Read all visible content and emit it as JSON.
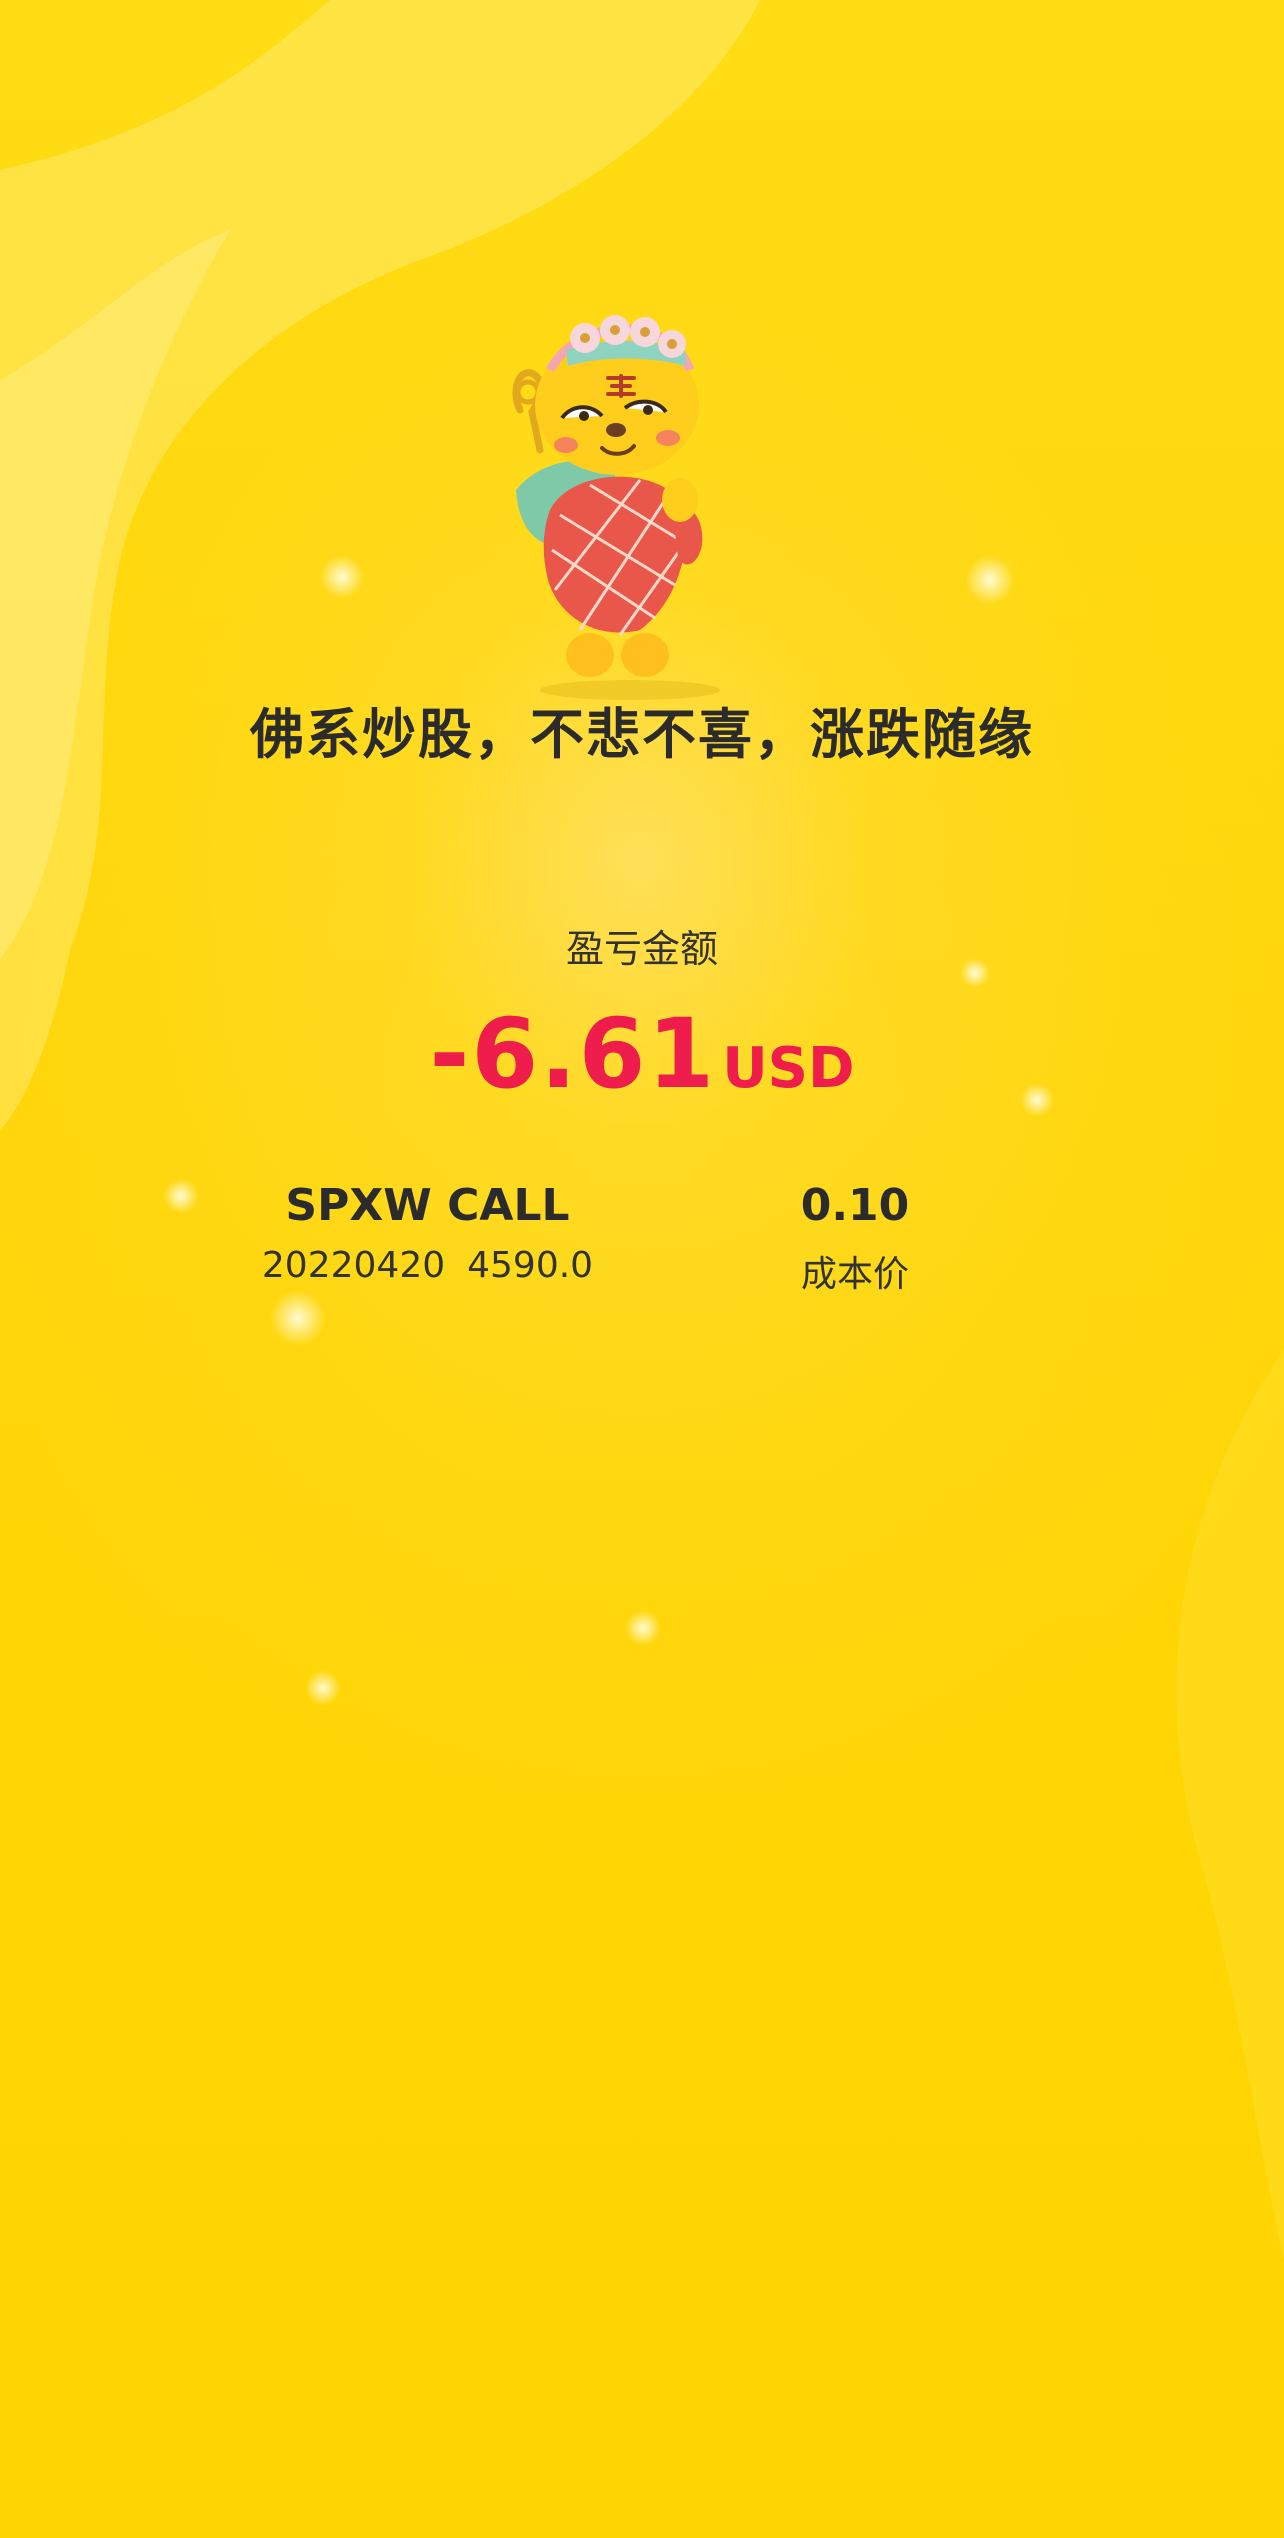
{
  "slogan": "佛系炒股，不悲不喜，涨跌随缘",
  "pnl": {
    "label": "盈亏金额",
    "value": "-6.61",
    "currency": "USD",
    "color": "#ee1d4c"
  },
  "contract": {
    "name": "SPXW CALL",
    "expiry": "20220420",
    "strike": "4590.0"
  },
  "cost": {
    "value": "0.10",
    "label": "成本价"
  },
  "colors": {
    "background": "#ffd60a",
    "text": "#2b2b2b"
  },
  "mascot": {
    "icon": "buddha-tiger-mascot-icon"
  }
}
